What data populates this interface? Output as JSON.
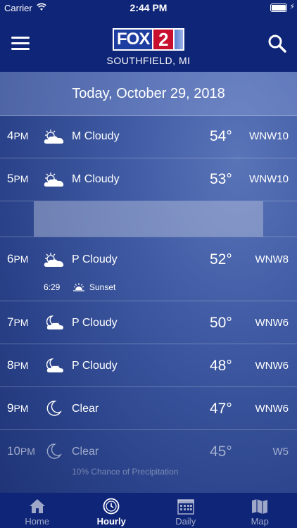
{
  "status_bar": {
    "carrier": "Carrier",
    "time": "2:44 PM"
  },
  "header": {
    "logo_fox": "FOX",
    "logo_number": "2",
    "location": "SOUTHFIELD, MI"
  },
  "date": "Today, October 29, 2018",
  "hours": [
    {
      "hour": "4",
      "ampm": "PM",
      "icon": "partly-cloudy-day-icon",
      "condition": "M Cloudy",
      "temp": "54°",
      "wind": "WNW10"
    },
    {
      "hour": "5",
      "ampm": "PM",
      "icon": "partly-cloudy-day-icon",
      "condition": "M Cloudy",
      "temp": "53°",
      "wind": "WNW10"
    },
    {
      "hour": "6",
      "ampm": "PM",
      "icon": "partly-cloudy-day-icon",
      "condition": "P Cloudy",
      "temp": "52°",
      "wind": "WNW8"
    },
    {
      "hour": "7",
      "ampm": "PM",
      "icon": "partly-cloudy-night-icon",
      "condition": "P Cloudy",
      "temp": "50°",
      "wind": "WNW6"
    },
    {
      "hour": "8",
      "ampm": "PM",
      "icon": "partly-cloudy-night-icon",
      "condition": "P Cloudy",
      "temp": "48°",
      "wind": "WNW6"
    },
    {
      "hour": "9",
      "ampm": "PM",
      "icon": "moon-icon",
      "condition": "Clear",
      "temp": "47°",
      "wind": "WNW6"
    },
    {
      "hour": "10",
      "ampm": "PM",
      "icon": "moon-icon",
      "condition": "Clear",
      "temp": "45°",
      "wind": "W5",
      "note": "10% Chance of Precipitation"
    }
  ],
  "sunset": {
    "time": "6:29",
    "label": "Sunset"
  },
  "tabs": [
    {
      "label": "Home",
      "icon": "home-icon"
    },
    {
      "label": "Hourly",
      "icon": "clock-icon"
    },
    {
      "label": "Daily",
      "icon": "calendar-icon"
    },
    {
      "label": "Map",
      "icon": "map-icon"
    }
  ],
  "colors": {
    "header": "#0f2577",
    "logo_red": "#c8102e"
  }
}
